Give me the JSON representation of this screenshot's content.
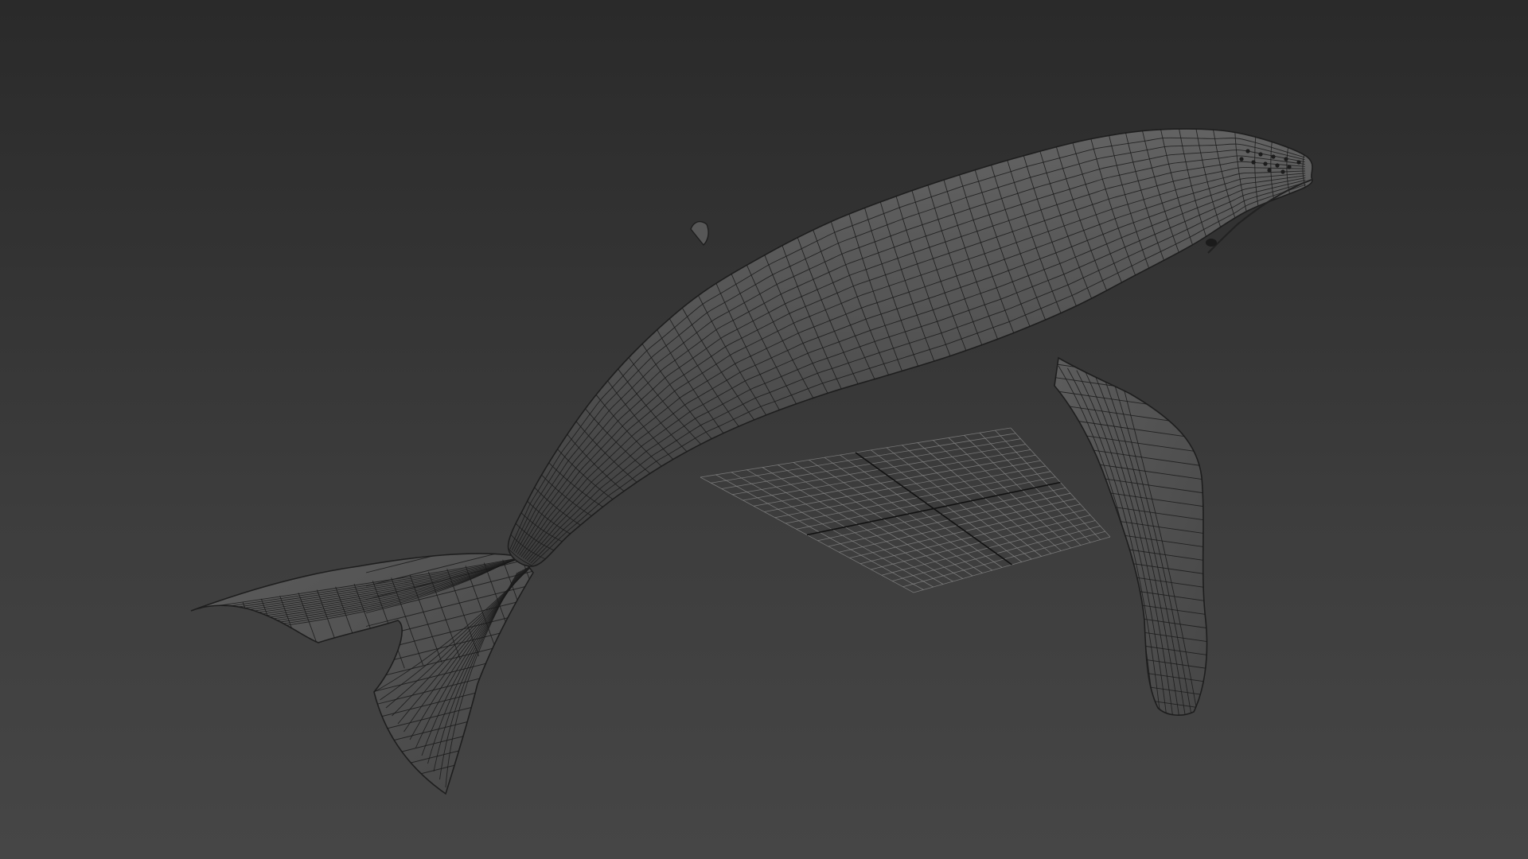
{
  "viewport": {
    "background_top": "#2a2a2a",
    "background_bottom": "#464646",
    "mesh_fill": "#505050",
    "mesh_fill_light": "#5e5e5e",
    "mesh_fill_dark": "#3a3a3a",
    "wire_color": "#1a1a1a",
    "grid_color": "#8a8a8a",
    "grid_axis_color": "#111111"
  },
  "scene": {
    "object": "humpback-whale-mesh",
    "display_mode": "smooth-shaded-with-wireframe",
    "grid_visible": true
  }
}
